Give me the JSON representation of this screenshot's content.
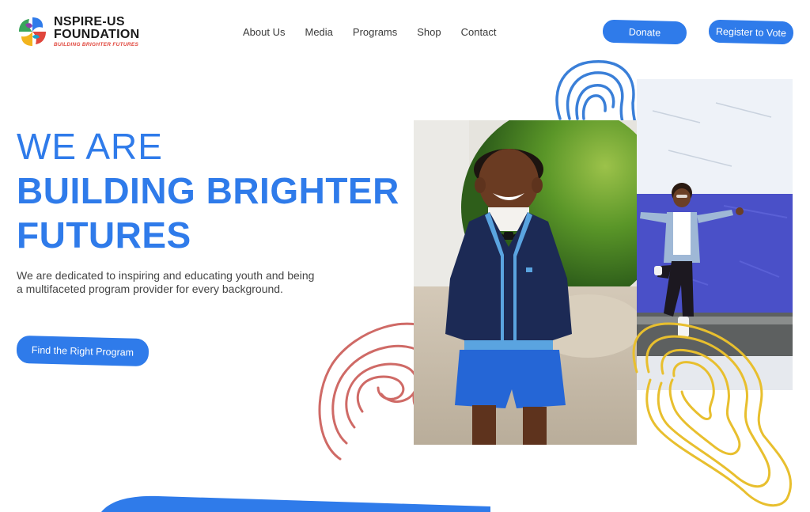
{
  "logo": {
    "line1": "NSPIRE-US",
    "line2": "FOUNDATION",
    "tagline": "BUILDING BRIGHTER FUTURES"
  },
  "nav": {
    "items": [
      {
        "label": "About Us"
      },
      {
        "label": "Media"
      },
      {
        "label": "Programs"
      },
      {
        "label": "Shop"
      },
      {
        "label": "Contact"
      }
    ]
  },
  "header": {
    "donate_label": "Donate",
    "vote_label": "Register to Vote"
  },
  "hero": {
    "line1": "WE ARE",
    "line2": "BUILDING BRIGHTER",
    "line3": "FUTURES",
    "description": "We are dedicated to inspiring and educating youth and being a multifaceted program provider for every background.",
    "cta_label": "Find the Right Program"
  },
  "colors": {
    "accent": "#2f7bea",
    "squiggle_blue": "#3a7fd8",
    "squiggle_red": "#cf6a66",
    "squiggle_yellow": "#e8bf2e",
    "logo_tagline": "#e0463c"
  },
  "icons": {
    "logo": "foundation-logo-icon"
  }
}
